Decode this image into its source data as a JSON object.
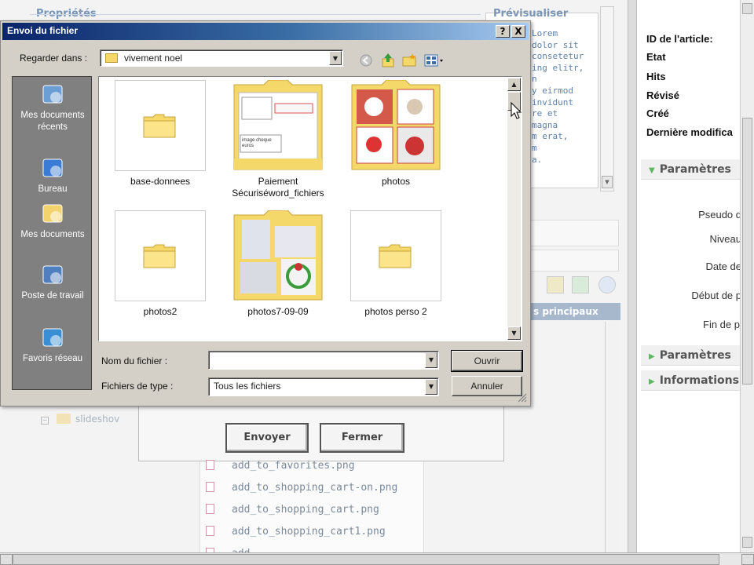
{
  "background": {
    "fieldset_properties": "Propriétés",
    "fieldset_preview": "Prévisualiser",
    "preview_lines": [
      "Lorem",
      "dolor sit",
      "consetetur",
      "ing elitr,",
      "n",
      "y eirmod",
      "invidunt",
      "re et",
      "magna",
      "m erat,",
      "m",
      "a."
    ],
    "tab_principaux": "s principaux",
    "tree_item": "slideshov",
    "file_list": [
      "add_to_favorites.png",
      "add_to_shopping_cart-on.png",
      "add_to_shopping_cart.png",
      "add_to_shopping_cart1.png",
      "add..."
    ],
    "send_button": "Envoyer",
    "close_button": "Fermer"
  },
  "right_panel": {
    "info_labels": [
      "ID de l'article:",
      "Etat",
      "Hits",
      "Révisé",
      "Créé",
      "Dernière modifica"
    ],
    "section_parametres": "Paramètres",
    "fields": [
      "Pseudo d",
      "Niveau",
      "Date de",
      "Début de p",
      "Fin de p"
    ],
    "section_parametres2": "Paramètres",
    "section_informations": "Informations"
  },
  "dialog": {
    "title": "Envoi du fichier",
    "help_btn": "?",
    "close_btn": "X",
    "look_in_label": "Regarder dans :",
    "look_in_value": "vivement noel",
    "places": [
      {
        "label": "Mes documents récents",
        "icon": "recent-documents-icon"
      },
      {
        "label": "Bureau",
        "icon": "desktop-icon"
      },
      {
        "label": "Mes documents",
        "icon": "my-documents-icon"
      },
      {
        "label": "Poste de travail",
        "icon": "my-computer-icon"
      },
      {
        "label": "Favoris réseau",
        "icon": "network-places-icon"
      }
    ],
    "files": [
      {
        "name": "base-donnees",
        "kind": "folder"
      },
      {
        "name": "Paiement Sécuriséword_fichiers",
        "kind": "folder-preview"
      },
      {
        "name": "photos",
        "kind": "folder-preview"
      },
      {
        "name": "photos2",
        "kind": "folder"
      },
      {
        "name": "photos7-09-09",
        "kind": "folder-preview"
      },
      {
        "name": "photos perso 2",
        "kind": "folder"
      }
    ],
    "paiement_thumb_text": "image cheque euros",
    "filename_label": "Nom du fichier :",
    "filename_value": "",
    "filetype_label": "Fichiers de type :",
    "filetype_value": "Tous les fichiers",
    "open_button": "Ouvrir",
    "cancel_button": "Annuler"
  }
}
